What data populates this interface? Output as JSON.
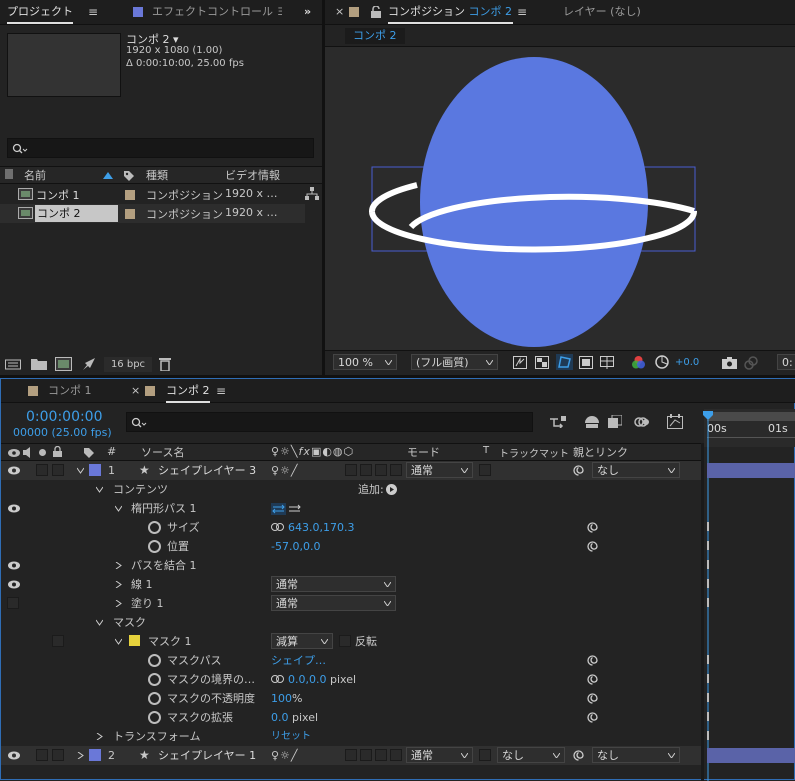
{
  "project": {
    "tab_label": "プロジェクト",
    "effect_tab_label": "エフェクトコントロール ヨ",
    "comp_name": "コンポ 2 ▾",
    "comp_size": "1920 x 1080 (1.00)",
    "comp_duration": "Δ 0:00:10:00, 25.00 fps",
    "search_placeholder": "",
    "col_name": "名前",
    "col_type": "種類",
    "col_video": "ビデオ情報",
    "items": [
      {
        "name": "コンポ 1",
        "type": "コンポジション",
        "video": "1920 x …"
      },
      {
        "name": "コンポ 2",
        "type": "コンポジション",
        "video": "1920 x …"
      }
    ],
    "bpc": "16 bpc"
  },
  "viewer": {
    "tab_label": "コンポジション",
    "tab_comp": "コンポ 2",
    "layer_tab": "レイヤー (なし)",
    "sub_tab": "コンポ 2",
    "zoom": "100 %",
    "quality": "(フル画質)",
    "exposure": "+0.0",
    "timecode_short": "0:"
  },
  "timeline": {
    "tab1": "コンポ 1",
    "tab2": "コンポ 2",
    "timecode": "0:00:00:00",
    "frames": "00000 (25.00 fps)",
    "col_source": "ソース名",
    "col_mode": "モード",
    "col_t": "T",
    "col_trackmatte": "トラックマット",
    "col_parent": "親とリンク",
    "ruler": [
      "00s",
      "01s"
    ],
    "layer1": {
      "num": "1",
      "name": "シェイプレイヤー 3",
      "mode": "通常",
      "parent": "なし"
    },
    "contents": "コンテンツ",
    "add_label": "追加:",
    "ellipse_path": "楕円形パス 1",
    "size_label": "サイズ",
    "size_value": "643.0,170.3",
    "position_label": "位置",
    "position_value": "-57.0,0.0",
    "merge_paths": "パスを結合 1",
    "stroke": "線 1",
    "stroke_mode": "通常",
    "fill": "塗り 1",
    "fill_mode": "通常",
    "mask_group": "マスク",
    "mask1": "マスク 1",
    "mask_mode": "減算",
    "invert": "反転",
    "mask_path": "マスクパス",
    "mask_path_value": "シェイプ…",
    "mask_feather": "マスクの境界の…",
    "mask_feather_value": "0.0,0.0",
    "mask_feather_unit": "pixel",
    "mask_opacity": "マスクの不透明度",
    "mask_opacity_value": "100",
    "mask_opacity_unit": "%",
    "mask_expansion": "マスクの拡張",
    "mask_expansion_value": "0.0",
    "mask_expansion_unit": "pixel",
    "transform": "トランスフォーム",
    "reset": "リセット",
    "layer2": {
      "num": "2",
      "name": "シェイプレイヤー 1",
      "mode": "通常",
      "trackmatte": "なし",
      "parent": "なし"
    }
  },
  "colors": {
    "accent": "#3d9ee8",
    "layer_label": "#6a78d8",
    "planet": "#5a78e0",
    "mask_label": "#e6d23c"
  }
}
